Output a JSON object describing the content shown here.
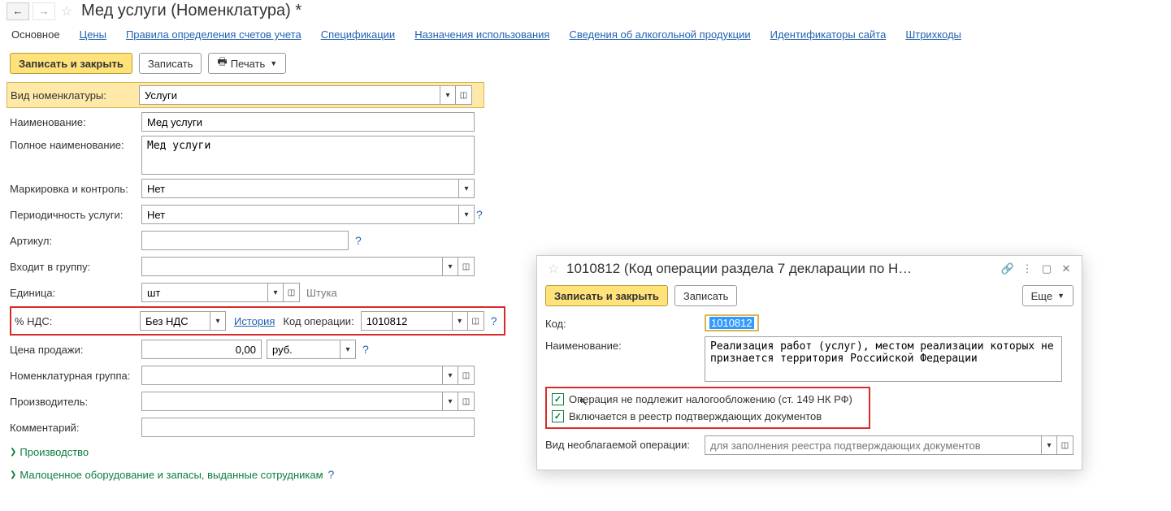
{
  "header": {
    "page_title": "Мед услуги (Номенклатура) *"
  },
  "tabs": [
    "Основное",
    "Цены",
    "Правила определения счетов учета",
    "Спецификации",
    "Назначения использования",
    "Сведения об алкогольной продукции",
    "Идентификаторы сайта",
    "Штрихкоды"
  ],
  "toolbar": {
    "write_close": "Записать и закрыть",
    "write": "Записать",
    "print": "Печать"
  },
  "form": {
    "type_label": "Вид номенклатуры:",
    "type_value": "Услуги",
    "name_label": "Наименование:",
    "name_value": "Мед услуги",
    "fullname_label": "Полное наименование:",
    "fullname_value": "Мед услуги",
    "marking_label": "Маркировка и контроль:",
    "marking_value": "Нет",
    "period_label": "Периодичность услуги:",
    "period_value": "Нет",
    "article_label": "Артикул:",
    "article_value": "",
    "group_label": "Входит в группу:",
    "group_value": "",
    "unit_label": "Единица:",
    "unit_value": "шт",
    "unit_desc": "Штука",
    "vat_label": "% НДС:",
    "vat_value": "Без НДС",
    "history_link": "История",
    "opcode_label": "Код операции:",
    "opcode_value": "1010812",
    "price_label": "Цена продажи:",
    "price_value": "0,00",
    "price_currency": "руб.",
    "nomgroup_label": "Номенклатурная группа:",
    "nomgroup_value": "",
    "manuf_label": "Производитель:",
    "manuf_value": "",
    "comment_label": "Комментарий:",
    "comment_value": "",
    "section_prod": "Производство",
    "section_low": "Малоценное оборудование и запасы, выданные сотрудникам"
  },
  "dialog": {
    "title": "1010812 (Код операции раздела 7 декларации по Н…",
    "write_close": "Записать и закрыть",
    "write": "Записать",
    "more": "Еще",
    "code_label": "Код:",
    "code_value": "1010812",
    "name_label": "Наименование:",
    "name_value": "Реализация работ (услуг), местом реализации которых не признается территория Российской Федерации",
    "chk1": "Операция не подлежит налогообложению (ст. 149 НК РФ)",
    "chk2": "Включается в реестр подтверждающих документов",
    "nontax_label": "Вид необлагаемой операции:",
    "nontax_placeholder": "для заполнения реестра подтверждающих документов"
  }
}
